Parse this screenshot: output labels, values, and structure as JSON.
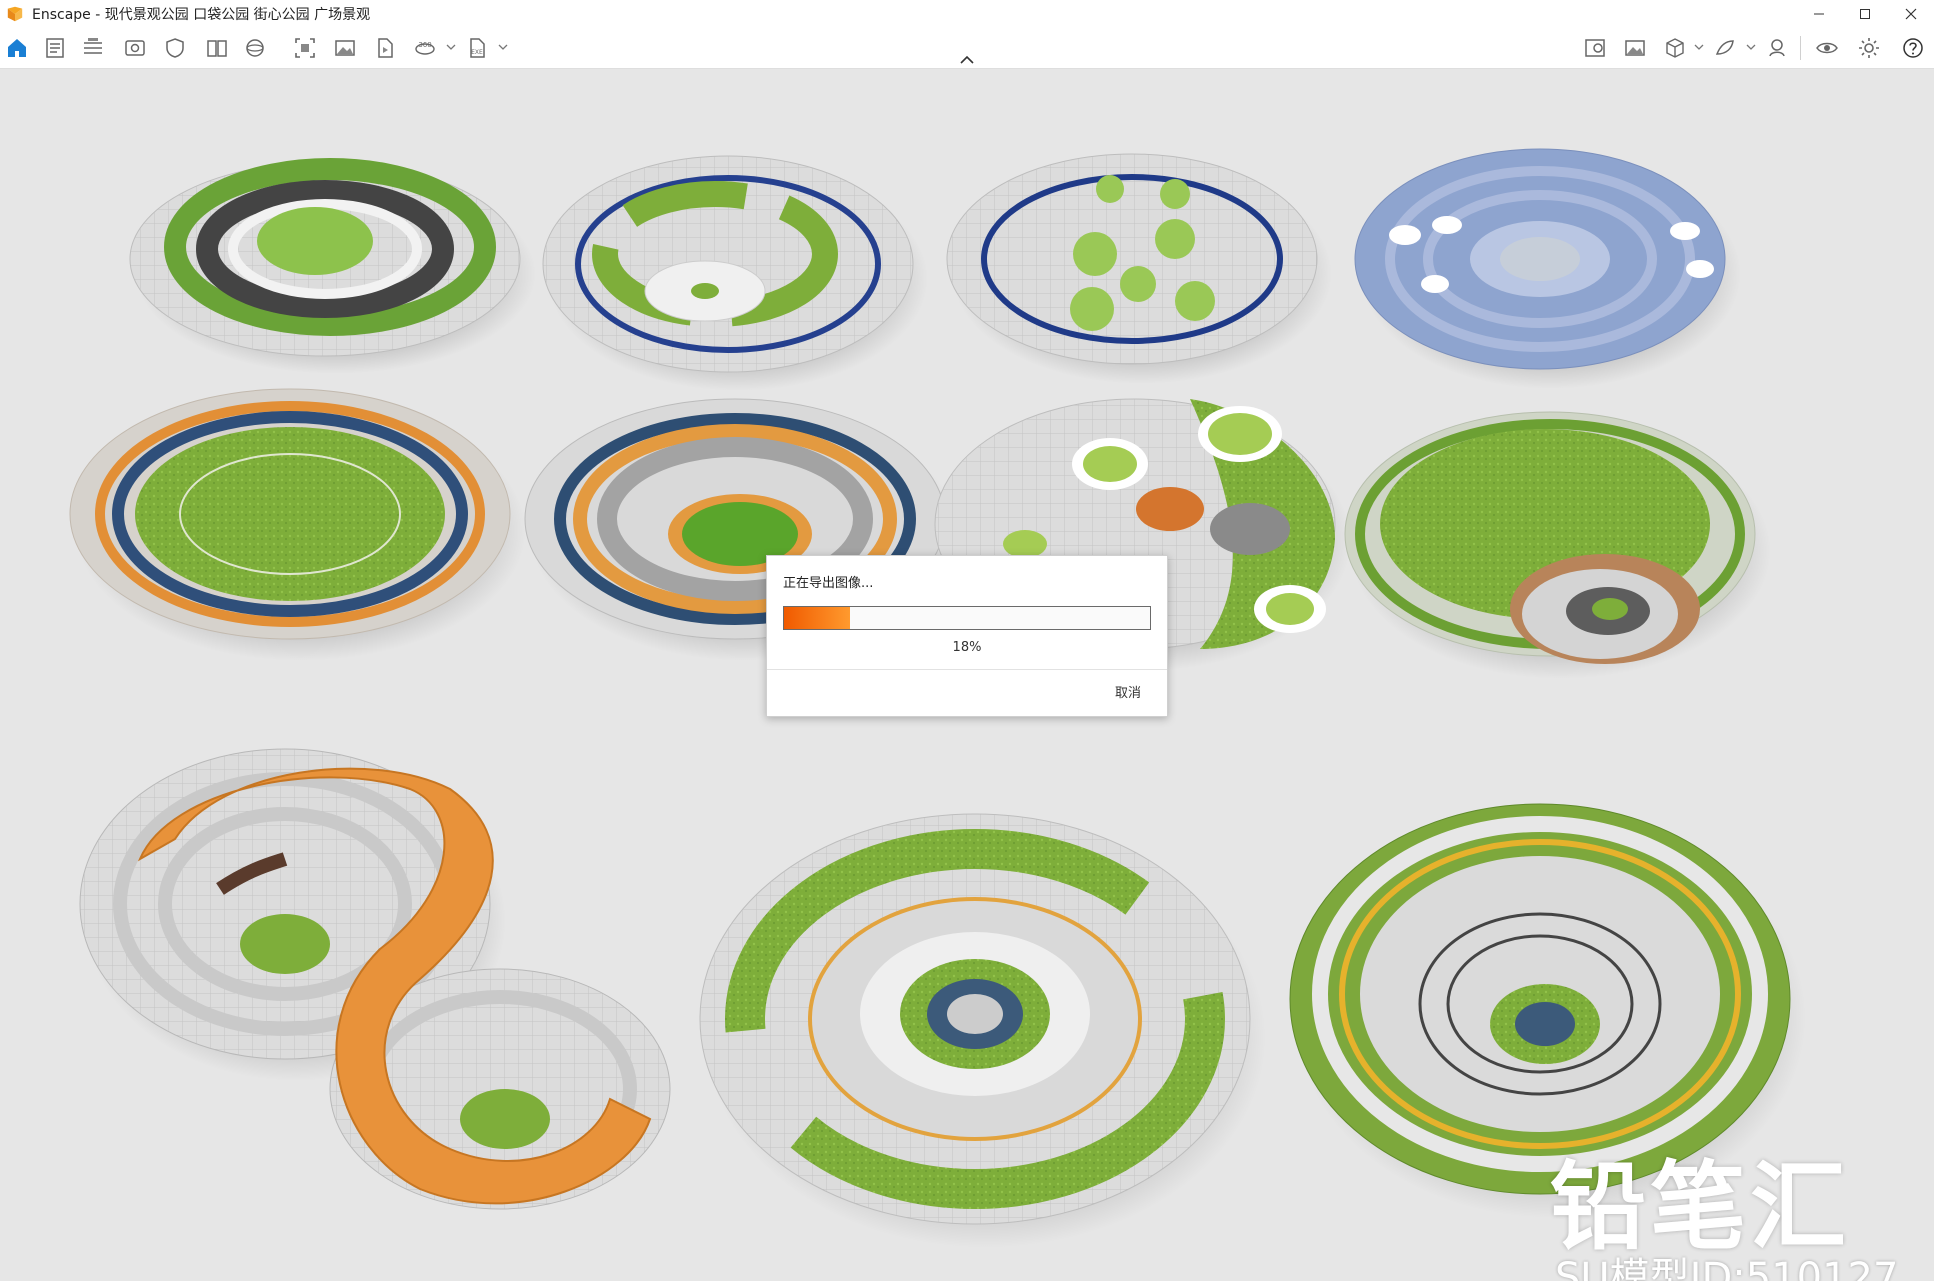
{
  "window": {
    "title": "Enscape - 现代景观公园 口袋公园 街心公园 广场景观",
    "accent": "#1a7fd4"
  },
  "toolbar": {
    "left_icons": [
      "home-icon",
      "document-icon",
      "bim-icon",
      "view-icon",
      "shield-icon",
      "book-icon",
      "sphere-icon",
      "screenshot-icon",
      "image-icon",
      "video-icon",
      "panorama-360-icon",
      "exe-export-icon"
    ],
    "right_icons": [
      "image-map-icon",
      "gallery-icon",
      "cube-icon",
      "material-icon",
      "asset-icon",
      "eye-icon",
      "settings-icon",
      "help-icon"
    ]
  },
  "dialog": {
    "title": "正在导出图像...",
    "progress": 0.18,
    "progress_label": "18%",
    "cancel_label": "取消"
  },
  "watermark": {
    "brand": "铅笔汇",
    "id_text": "SU模型ID:510127"
  }
}
